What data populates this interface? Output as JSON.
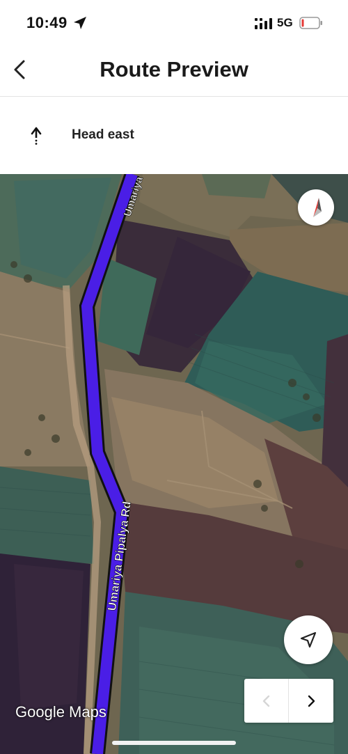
{
  "status_bar": {
    "time": "10:49",
    "network": "5G",
    "battery_color": "#e53935"
  },
  "header": {
    "title": "Route Preview",
    "back_icon": "chevron-left-icon"
  },
  "direction": {
    "icon": "arrow-up-icon",
    "text": "Head east"
  },
  "map": {
    "route_color": "#4a1ee6",
    "road_labels": [
      "Umariya",
      "Umariya Pipalya Rd"
    ],
    "attribution": "Google Maps"
  },
  "controls": {
    "compass_icon": "compass-icon",
    "recenter_icon": "navigation-arrow-icon",
    "prev_icon": "chevron-left-icon",
    "next_icon": "chevron-right-icon",
    "prev_enabled": false,
    "next_enabled": true
  }
}
